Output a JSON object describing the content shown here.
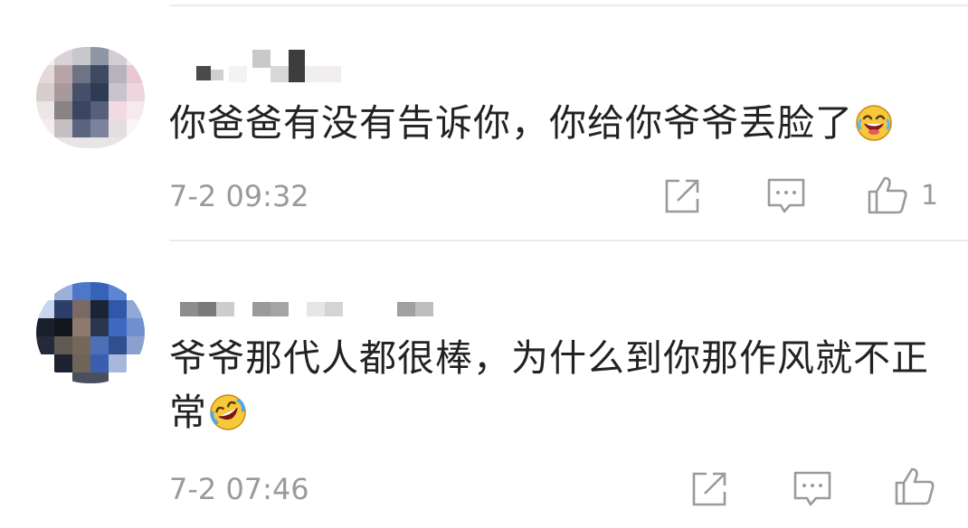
{
  "comments": [
    {
      "text": "你爸爸有没有告诉你，你给你爷爷丢脸了",
      "emoji": "grinning-tears-face-icon",
      "time": "7-2 09:32",
      "like_count": "1"
    },
    {
      "text": "爷爷那代人都很棒，为什么到你那作风就不正常",
      "emoji": "rolling-laughing-face-icon",
      "time": "7-2 07:46",
      "like_count": ""
    }
  ],
  "icons": {
    "share": "share-icon",
    "comment": "comment-icon",
    "like": "thumbs-up-icon"
  },
  "colors": {
    "text": "#222222",
    "meta": "#9a9a9a",
    "divider": "#ececec"
  }
}
